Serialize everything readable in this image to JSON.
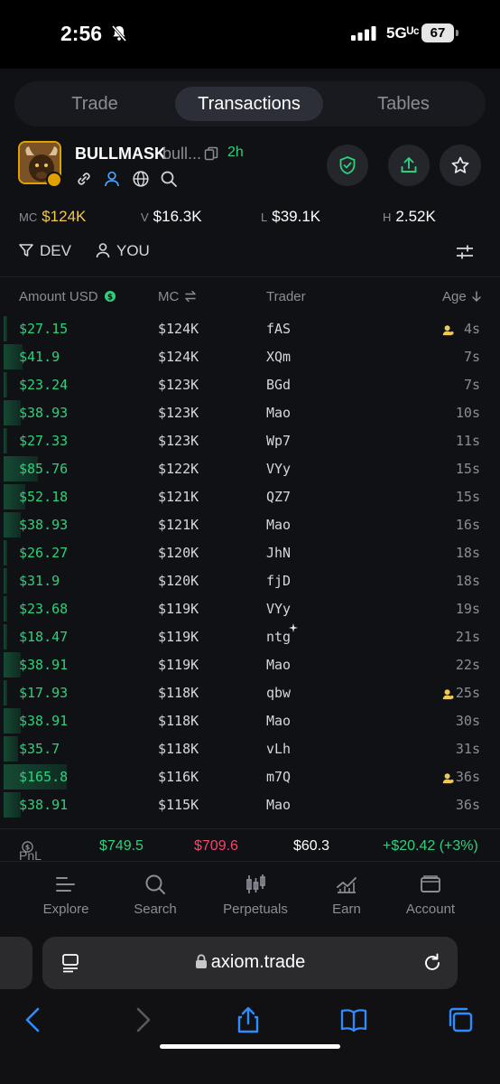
{
  "status_bar": {
    "time": "2:56",
    "network": "5Gᵁᶜ",
    "battery": "67"
  },
  "tabs": [
    {
      "label": "Trade",
      "active": false
    },
    {
      "label": "Transactions",
      "active": true
    },
    {
      "label": "Tables",
      "active": false
    }
  ],
  "token": {
    "name": "BULLMASK",
    "subname": "bull...",
    "age": "2h"
  },
  "stats": {
    "mc_label": "MC",
    "mc_value": "$124K",
    "v_label": "V",
    "v_value": "$16.3K",
    "l_label": "L",
    "l_value": "$39.1K",
    "h_label": "H",
    "h_value": "2.52K"
  },
  "filters": {
    "dev": "DEV",
    "you": "YOU"
  },
  "columns": {
    "amount": "Amount USD",
    "mc": "MC",
    "trader": "Trader",
    "age": "Age"
  },
  "rows": [
    {
      "amount": "$27.15",
      "mc": "$124K",
      "trader": "fAS",
      "age": "4s",
      "badge": true,
      "bar": 0.0
    },
    {
      "amount": "$41.9",
      "mc": "$124K",
      "trader": "XQm",
      "age": "7s",
      "badge": false,
      "bar": 0.25
    },
    {
      "amount": "$23.24",
      "mc": "$123K",
      "trader": "BGd",
      "age": "7s",
      "badge": false,
      "bar": 0.0
    },
    {
      "amount": "$38.93",
      "mc": "$123K",
      "trader": "Mao",
      "age": "10s",
      "badge": false,
      "bar": 0.23
    },
    {
      "amount": "$27.33",
      "mc": "$123K",
      "trader": "Wp7",
      "age": "11s",
      "badge": false,
      "bar": 0.0
    },
    {
      "amount": "$85.76",
      "mc": "$122K",
      "trader": "VYy",
      "age": "15s",
      "badge": false,
      "bar": 0.52
    },
    {
      "amount": "$52.18",
      "mc": "$121K",
      "trader": "QZ7",
      "age": "15s",
      "badge": false,
      "bar": 0.3
    },
    {
      "amount": "$38.93",
      "mc": "$121K",
      "trader": "Mao",
      "age": "16s",
      "badge": false,
      "bar": 0.23
    },
    {
      "amount": "$26.27",
      "mc": "$120K",
      "trader": "JhN",
      "age": "18s",
      "badge": false,
      "bar": 0.0
    },
    {
      "amount": "$31.9",
      "mc": "$120K",
      "trader": "fjD",
      "age": "18s",
      "badge": false,
      "bar": 0.0
    },
    {
      "amount": "$23.68",
      "mc": "$119K",
      "trader": "VYy",
      "age": "19s",
      "badge": false,
      "bar": 0.0
    },
    {
      "amount": "$18.47",
      "mc": "$119K",
      "trader": "ntg",
      "age": "21s",
      "badge": false,
      "bar": 0.0
    },
    {
      "amount": "$38.91",
      "mc": "$119K",
      "trader": "Mao",
      "age": "22s",
      "badge": false,
      "bar": 0.23
    },
    {
      "amount": "$17.93",
      "mc": "$118K",
      "trader": "qbw",
      "age": "25s",
      "badge": true,
      "bar": 0.0
    },
    {
      "amount": "$38.91",
      "mc": "$118K",
      "trader": "Mao",
      "age": "30s",
      "badge": false,
      "bar": 0.23
    },
    {
      "amount": "$35.7",
      "mc": "$118K",
      "trader": "vLh",
      "age": "31s",
      "badge": false,
      "bar": 0.18
    },
    {
      "amount": "$165.8",
      "mc": "$116K",
      "trader": "m7Q",
      "age": "36s",
      "badge": true,
      "bar": 1.0
    },
    {
      "amount": "$38.91",
      "mc": "$115K",
      "trader": "Mao",
      "age": "36s",
      "badge": false,
      "bar": 0.23
    }
  ],
  "pnl": {
    "label": "PnL",
    "bought": "$749.5",
    "sold": "$709.6",
    "holding": "$60.3",
    "pnl": "+$20.42 (+3%)"
  },
  "nav": [
    {
      "label": "Explore",
      "icon": "explore-icon"
    },
    {
      "label": "Search",
      "icon": "search-icon"
    },
    {
      "label": "Perpetuals",
      "icon": "candles-icon"
    },
    {
      "label": "Earn",
      "icon": "chart-icon"
    },
    {
      "label": "Account",
      "icon": "wallet-icon"
    }
  ],
  "browser": {
    "url": "axiom.trade"
  },
  "colors": {
    "accent_green": "#2ed07c",
    "sell_red": "#f0476e",
    "gold": "#f2c94c",
    "bg": "#101114"
  }
}
